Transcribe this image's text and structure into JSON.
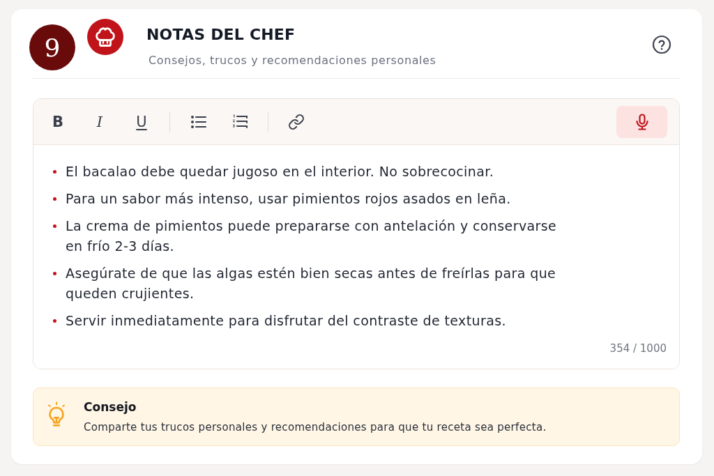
{
  "header": {
    "step_number": "9",
    "title": "NOTAS DEL CHEF",
    "subtitle": "Consejos, trucos y recomendaciones personales"
  },
  "editor": {
    "toolbar": [
      {
        "kind": "bold",
        "label": "B"
      },
      {
        "kind": "italic",
        "label": "I"
      },
      {
        "kind": "underline",
        "label": "U"
      },
      {
        "kind": "separator"
      },
      {
        "kind": "bullet-list"
      },
      {
        "kind": "numbered-list"
      },
      {
        "kind": "separator"
      },
      {
        "kind": "link"
      },
      {
        "kind": "microphone"
      }
    ],
    "notes": [
      "El bacalao debe quedar jugoso en el interior. No sobrecocinar.",
      "Para un sabor más intenso, usar pimientos rojos asados en leña.",
      "La crema de pimientos puede prepararse con antelación y conservarse en frío 2-3 días.",
      "Asegúrate de que las algas estén bien secas antes de freírlas para que queden crujientes.",
      "Servir inmediatamente para disfrutar del contraste de texturas."
    ],
    "counter": "354 / 1000"
  },
  "tip": {
    "title": "Consejo",
    "text": "Comparte tus trucos personales y recomendaciones para que tu receta sea perfecta."
  }
}
